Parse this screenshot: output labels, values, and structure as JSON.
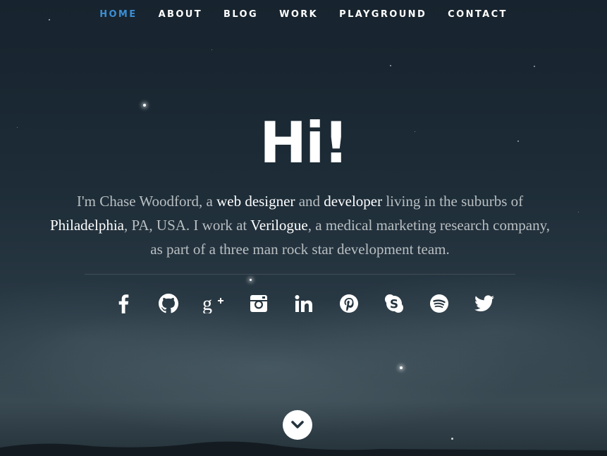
{
  "nav": {
    "items": [
      {
        "label": "HOME",
        "active": true
      },
      {
        "label": "ABOUT",
        "active": false
      },
      {
        "label": "BLOG",
        "active": false
      },
      {
        "label": "WORK",
        "active": false
      },
      {
        "label": "PLAYGROUND",
        "active": false
      },
      {
        "label": "CONTACT",
        "active": false
      }
    ],
    "active_color": "#3b8fd4"
  },
  "hero": {
    "heading": "Hi!",
    "intro": {
      "t1": "I'm Chase Woodford, a ",
      "b1": "web designer",
      "t2": " and ",
      "b2": "developer",
      "t3": " living in the suburbs of ",
      "b3": "Philadelphia",
      "t4": ", PA, USA. I work at ",
      "b4": "Verilogue",
      "t5": ", a medical marketing research company, as part of a three man rock star development team."
    }
  },
  "social": [
    "facebook-icon",
    "github-icon",
    "google-plus-icon",
    "instagram-icon",
    "linkedin-icon",
    "pinterest-icon",
    "skype-icon",
    "spotify-icon",
    "twitter-icon"
  ],
  "scroll_button": "chevron-down-icon"
}
